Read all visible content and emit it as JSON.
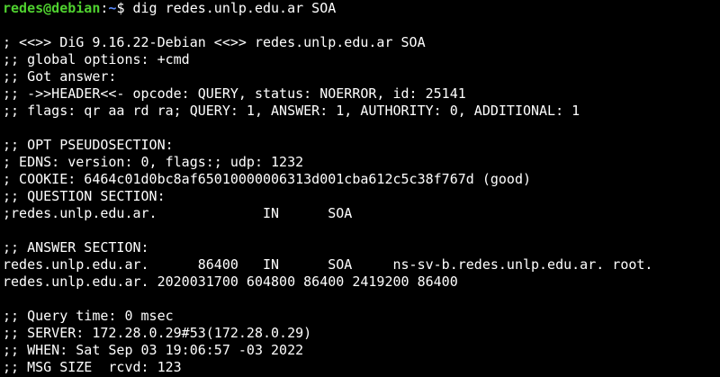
{
  "terminal": {
    "prompt": {
      "user_host": "redes@debian",
      "separator": ":",
      "path": "~",
      "symbol": "$ ",
      "command": "dig redes.unlp.edu.ar SOA"
    },
    "output": [
      "",
      "; <<>> DiG 9.16.22-Debian <<>> redes.unlp.edu.ar SOA",
      ";; global options: +cmd",
      ";; Got answer:",
      ";; ->>HEADER<<- opcode: QUERY, status: NOERROR, id: 25141",
      ";; flags: qr aa rd ra; QUERY: 1, ANSWER: 1, AUTHORITY: 0, ADDITIONAL: 1",
      "",
      ";; OPT PSEUDOSECTION:",
      "; EDNS: version: 0, flags:; udp: 1232",
      "; COOKIE: 6464c01d0bc8af65010000006313d001cba612c5c38f767d (good)",
      ";; QUESTION SECTION:",
      ";redes.unlp.edu.ar.             IN      SOA",
      "",
      ";; ANSWER SECTION:",
      "redes.unlp.edu.ar.      86400   IN      SOA     ns-sv-b.redes.unlp.edu.ar. root.",
      "redes.unlp.edu.ar. 2020031700 604800 86400 2419200 86400",
      "",
      ";; Query time: 0 msec",
      ";; SERVER: 172.28.0.29#53(172.28.0.29)",
      ";; WHEN: Sat Sep 03 19:06:57 -03 2022",
      ";; MSG SIZE  rcvd: 123"
    ]
  }
}
